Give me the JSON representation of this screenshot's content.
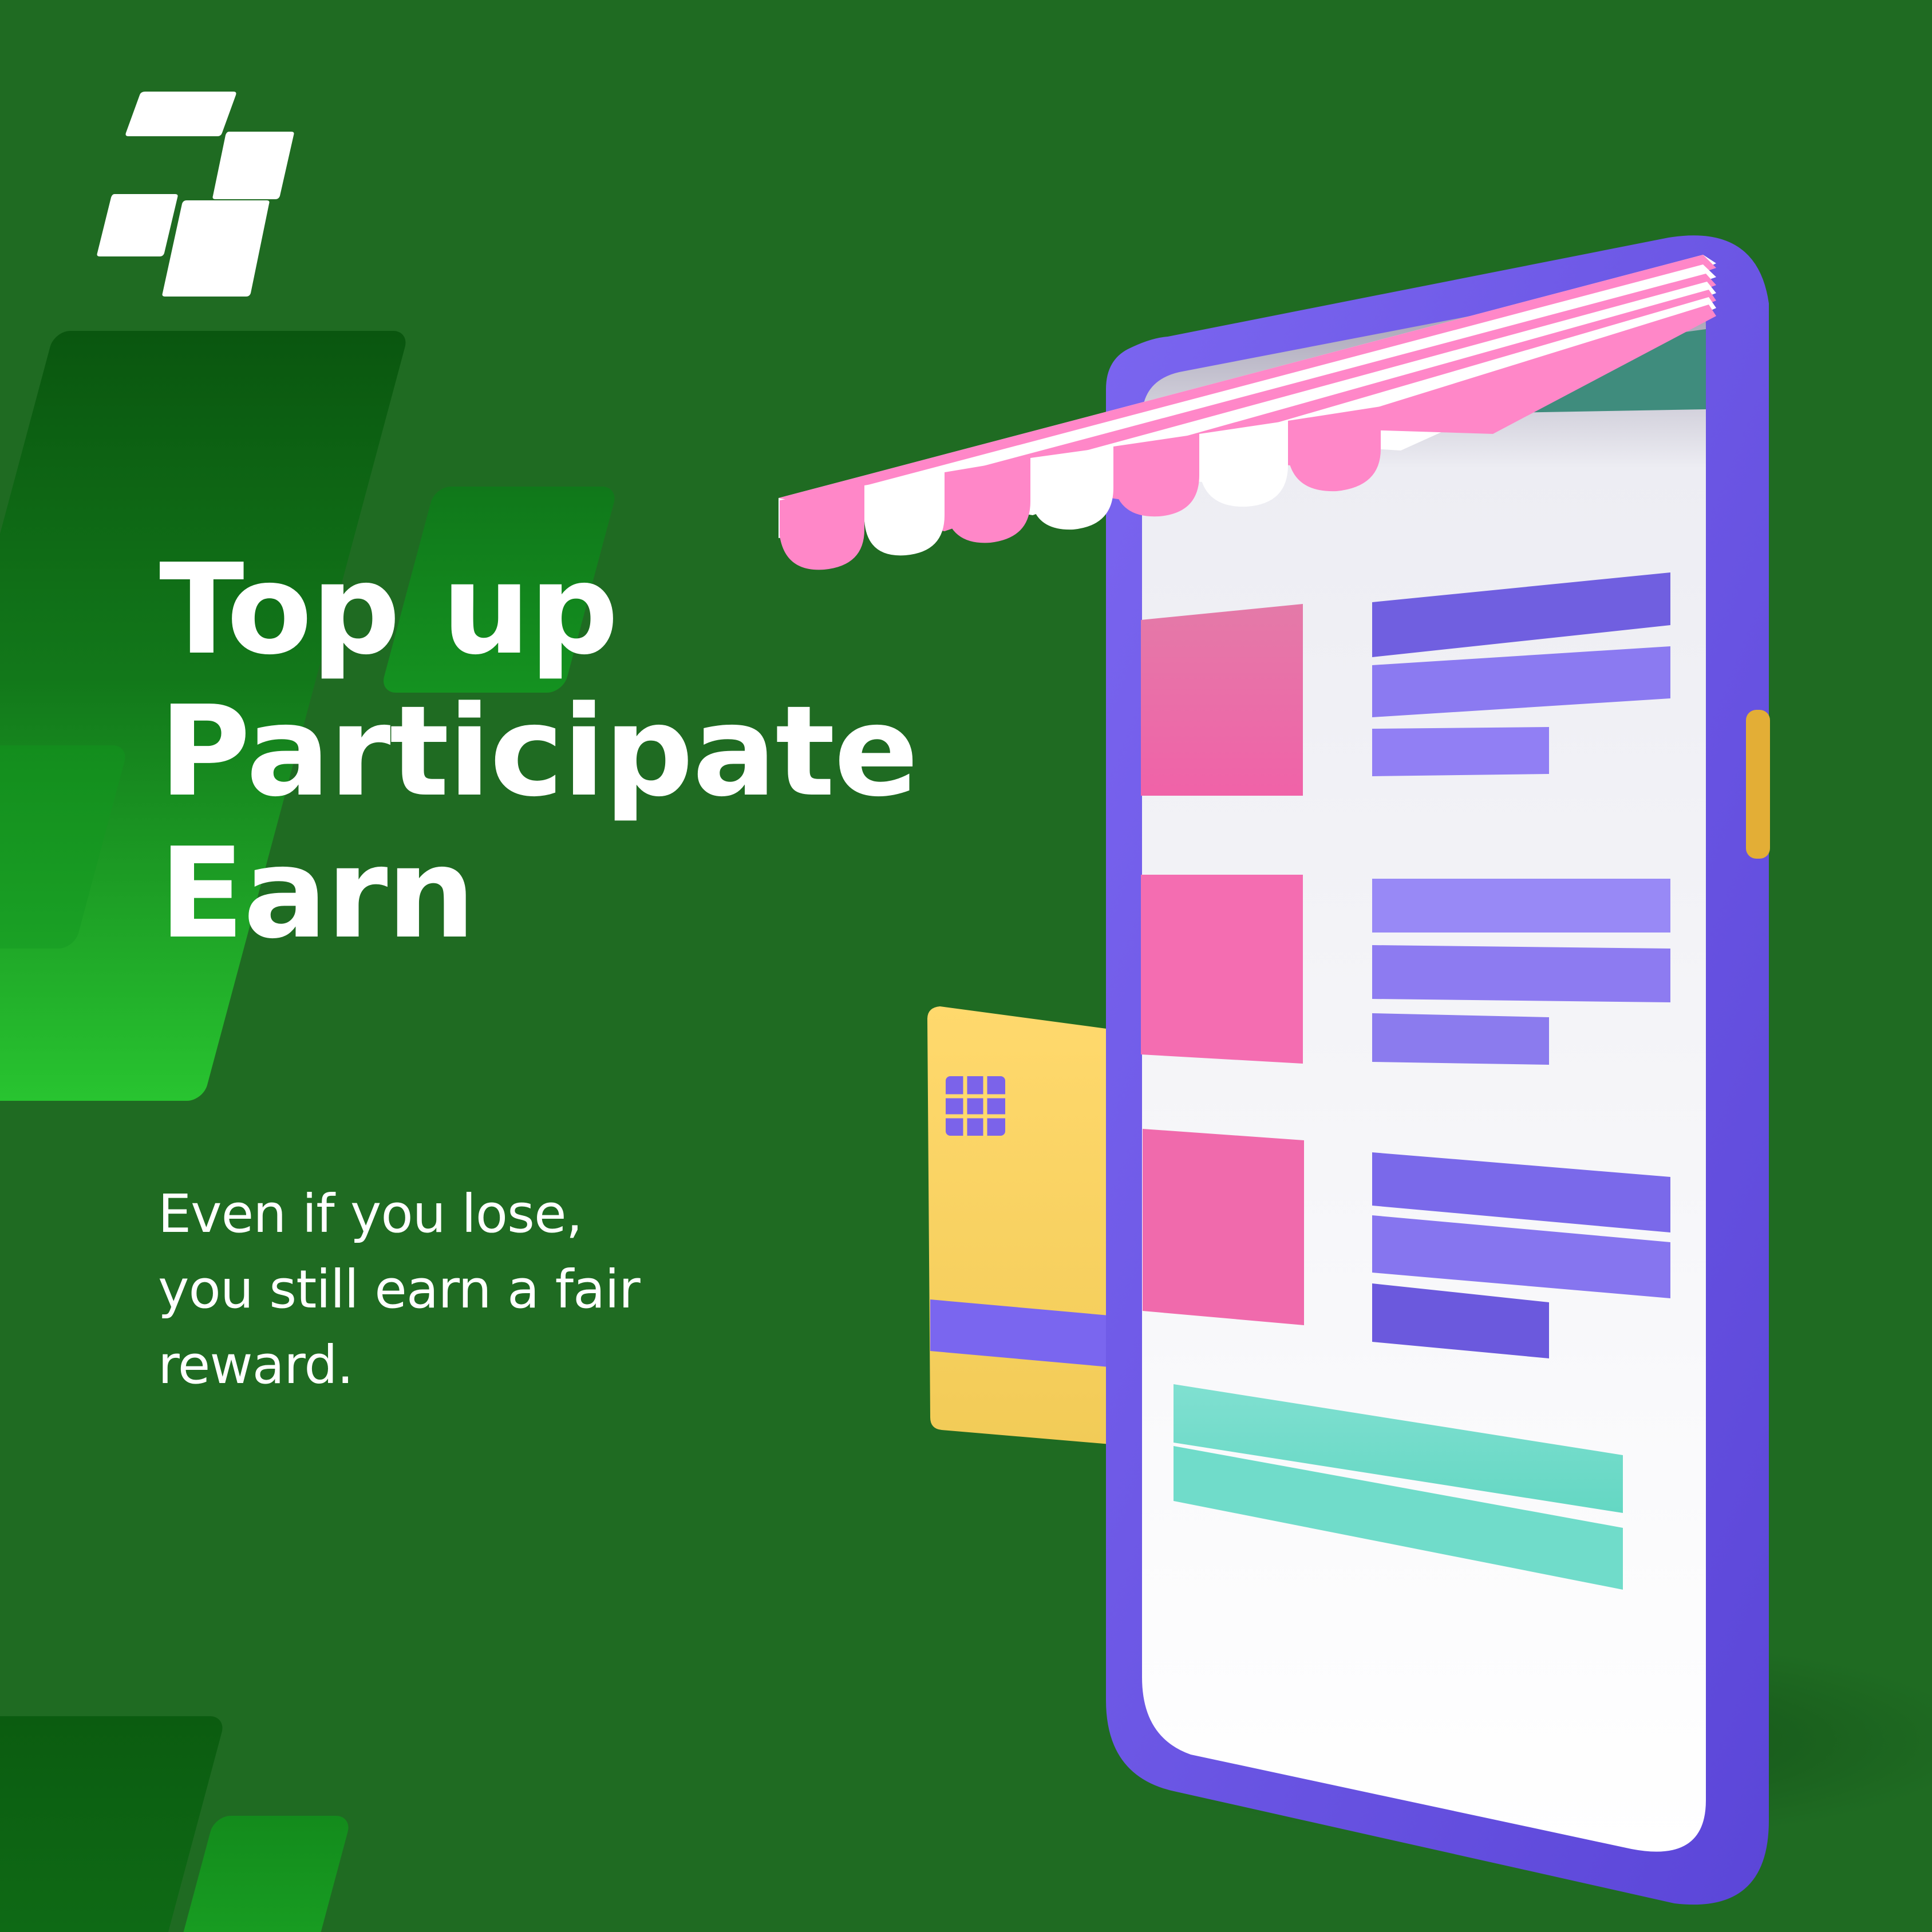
{
  "hero": {
    "headline": [
      "Top up",
      "Participate",
      "Earn"
    ],
    "subcopy": [
      "Even if you lose,",
      "you still earn a fair",
      "reward."
    ]
  },
  "brand": {
    "logo_icon": "parallelogram-blocks-logo",
    "accent_color": "#ffffff"
  },
  "palette": {
    "background": "#1f6b22",
    "panel_dark": "#0a560f",
    "panel_light": "#28c430",
    "phone_frame": "#6a56e5",
    "awning_pink": "#ff87c8",
    "awning_white": "#ffffff",
    "card_yellow": "#ffd86c",
    "screen_pink": "#f26fae",
    "screen_purple": "#8f7ff2",
    "screen_teal": "#72ddcc"
  },
  "illustration": {
    "phone_icon": "smartphone-storefront-icon",
    "card_icon": "credit-card-icon",
    "chip_icon": "card-chip-icon",
    "awning_icon": "striped-awning-icon"
  }
}
